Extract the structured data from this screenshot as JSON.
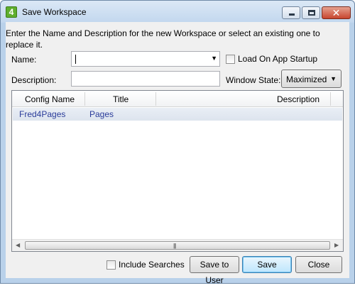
{
  "window": {
    "title": "Save Workspace",
    "app_icon_text": "4"
  },
  "form": {
    "instructions": "Enter the Name and Description for the new Workspace or select an existing one to replace it.",
    "name_label": "Name:",
    "name_value": "",
    "description_label": "Description:",
    "description_value": "",
    "load_on_startup_label": "Load On App Startup",
    "load_on_startup_checked": false,
    "window_state_label": "Window State:",
    "window_state_value": "Maximized"
  },
  "grid": {
    "columns": [
      "Config Name",
      "Title",
      "Description"
    ],
    "rows": [
      {
        "config_name": "Fred4Pages",
        "title": "Pages",
        "description": ""
      }
    ]
  },
  "footer": {
    "include_searches_label": "Include Searches",
    "include_searches_checked": false,
    "save_to_user_label": "Save to User",
    "save_label": "Save",
    "close_label": "Close"
  },
  "colors": {
    "title_bar": "#c2d7ee",
    "close_button": "#c7452e",
    "row_text": "#2a3c9a",
    "row_selected_bg": "#dde4ee"
  },
  "icons": {
    "app": "app-logo-icon",
    "minimize": "minimize-icon",
    "maximize": "maximize-icon",
    "close": "close-icon",
    "dropdown": "chevron-down-icon"
  }
}
